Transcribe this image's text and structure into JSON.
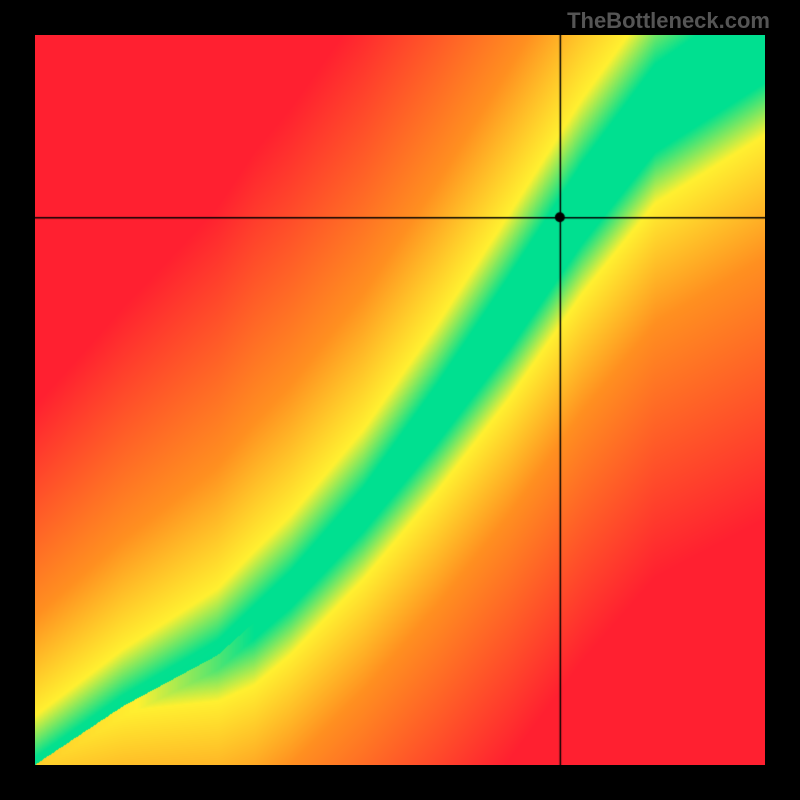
{
  "attribution": "TheBottleneck.com",
  "chart_data": {
    "type": "heatmap",
    "title": "",
    "xlabel": "",
    "ylabel": "",
    "x_range": [
      0,
      1
    ],
    "y_range": [
      0,
      1
    ],
    "crosshair": {
      "x": 0.72,
      "y": 0.75
    },
    "marker": {
      "x": 0.72,
      "y": 0.75
    },
    "green_band": {
      "description": "Optimal balance curve - narrow green band where CPU and GPU are well matched",
      "control_points": [
        {
          "x": 0.0,
          "y": 0.0,
          "width": 0.01
        },
        {
          "x": 0.12,
          "y": 0.08,
          "width": 0.015
        },
        {
          "x": 0.25,
          "y": 0.15,
          "width": 0.02
        },
        {
          "x": 0.35,
          "y": 0.24,
          "width": 0.025
        },
        {
          "x": 0.45,
          "y": 0.35,
          "width": 0.03
        },
        {
          "x": 0.55,
          "y": 0.48,
          "width": 0.04
        },
        {
          "x": 0.65,
          "y": 0.62,
          "width": 0.05
        },
        {
          "x": 0.75,
          "y": 0.77,
          "width": 0.055
        },
        {
          "x": 0.85,
          "y": 0.9,
          "width": 0.06
        },
        {
          "x": 1.0,
          "y": 1.0,
          "width": 0.065
        }
      ]
    },
    "color_scale": {
      "optimal": "#00e090",
      "near": "#fff030",
      "moderate": "#ff9020",
      "poor": "#ff2030"
    }
  }
}
